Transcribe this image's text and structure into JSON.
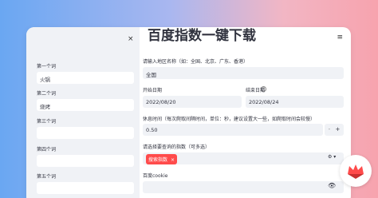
{
  "sidebar": {
    "close_label": "×",
    "fields": [
      {
        "label": "第一个词",
        "value": "火锅"
      },
      {
        "label": "第二个词",
        "value": "烧烤"
      },
      {
        "label": "第三个词",
        "value": ""
      },
      {
        "label": "第四个词",
        "value": ""
      },
      {
        "label": "第五个词",
        "value": ""
      }
    ]
  },
  "main": {
    "title": "百度指数一键下载",
    "menu_label": "≡",
    "region_label": "请输入地区名称（如：全国、北京、广东、香港）",
    "region_value": "全国",
    "start_label": "开始日期",
    "start_value": "2022/08/20",
    "end_label": "结束日期",
    "end_value": "2022/08/24",
    "help_glyph": "?",
    "rest_label": "休息时间（每次爬取间隔时间，单位：秒，建议设置大一些，如爬取时间会较慢）",
    "rest_value": "0.50",
    "rest_minus": "-",
    "rest_plus": "+",
    "index_label": "请选择要查询的指数（可多选）",
    "index_tags": [
      "搜索指数"
    ],
    "tag_remove": "×",
    "cookie_label": "百度cookie",
    "cookie_value": ""
  },
  "colors": {
    "accent": "#ff4b4b",
    "input_bg": "#f0f2f6",
    "sidebar_bg": "#f0f2f6",
    "text": "#31333f"
  }
}
